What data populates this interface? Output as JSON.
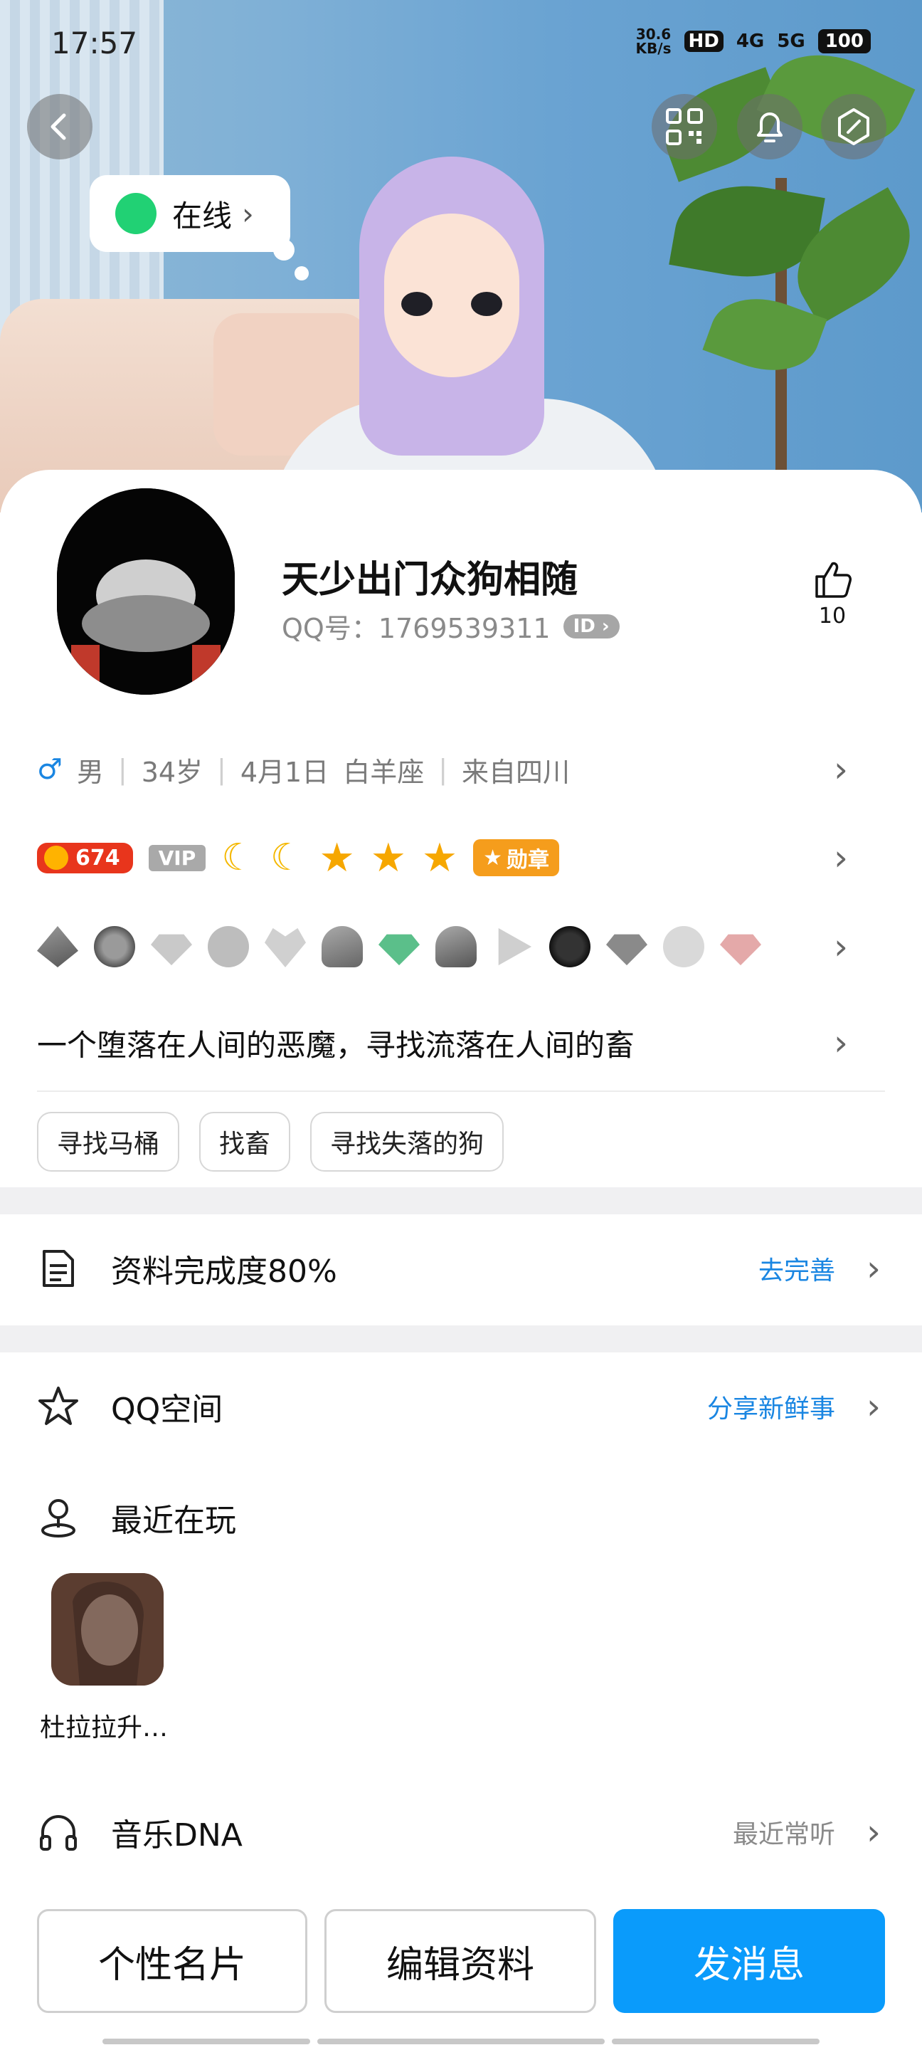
{
  "status_bar": {
    "time": "17:57",
    "speed": "30.6",
    "speed_unit": "KB/s",
    "hd": "HD",
    "net1": "4G",
    "net2": "5G",
    "battery": "100"
  },
  "profile": {
    "online_status": "在线",
    "nickname": "天少出门众狗相随",
    "qq_label": "QQ号：1769539311",
    "id_badge": "ID",
    "likes": "10",
    "gender": "男",
    "age": "34岁",
    "birthday": "4月1日",
    "zodiac": "白羊座",
    "hometown": "来自四川",
    "level": "674",
    "vip": "VIP",
    "medal": "勋章",
    "signature": "一个堕落在人间的恶魔，寻找流落在人间的畜",
    "tags": [
      "寻找马桶",
      "找畜",
      "寻找失落的狗"
    ]
  },
  "sections": {
    "completeness": {
      "label": "资料完成度80%",
      "action": "去完善"
    },
    "qzone": {
      "label": "QQ空间",
      "action": "分享新鲜事"
    },
    "recent_play": {
      "label": "最近在玩",
      "game": "杜拉拉升…"
    },
    "music": {
      "label": "音乐DNA",
      "action": "最近常听"
    }
  },
  "buttons": {
    "card": "个性名片",
    "edit": "编辑资料",
    "message": "发消息"
  },
  "colors": {
    "accent": "#0a9bfb",
    "link": "#1a86e2",
    "online": "#21d174"
  }
}
